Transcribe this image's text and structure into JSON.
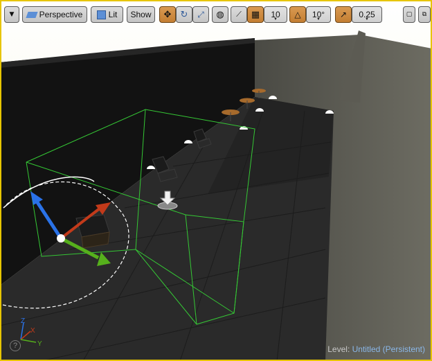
{
  "toolbar": {
    "perspective_label": "Perspective",
    "lit_label": "Lit",
    "show_label": "Show",
    "grid_snap_value": "10",
    "rotation_snap_value": "10°",
    "scale_snap_value": "0.25"
  },
  "axis_gizmo": {
    "x_label": "X",
    "y_label": "Y",
    "z_label": "Z"
  },
  "status": {
    "level_prefix": "Level:",
    "level_name": "Untitled (Persistent)",
    "help_glyph": "?"
  },
  "colors": {
    "accent_orange": "#c8822f",
    "selection_yellow": "#e7c500",
    "bounds_green": "#35c935"
  }
}
